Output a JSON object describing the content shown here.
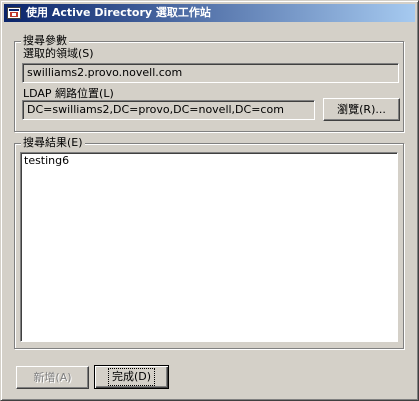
{
  "window": {
    "title": "使用 Active Directory 選取工作站",
    "title_icon": "app-icon"
  },
  "search_params": {
    "group_title": "搜尋參數",
    "domain_label": "選取的領域(S)",
    "domain_value": "swilliams2.provo.novell.com",
    "ldap_label": "LDAP 網路位置(L)",
    "ldap_value": "DC=swilliams2,DC=provo,DC=novell,DC=com",
    "browse_button": "瀏覽(R)..."
  },
  "results": {
    "group_title": "搜尋結果(E)",
    "items": [
      "testing6"
    ]
  },
  "footer": {
    "new_button": "新增(A)",
    "done_button": "完成(D)"
  },
  "colors": {
    "titlebar_start": "#0a246a",
    "titlebar_end": "#a6caf0",
    "face": "#d4d0c8"
  }
}
